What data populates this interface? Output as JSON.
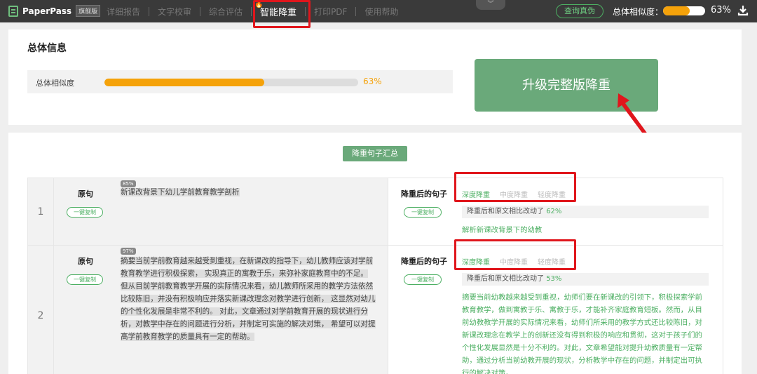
{
  "topbar": {
    "brand": "PaperPass",
    "edition": "旗舰版",
    "nav": [
      "详细报告",
      "文字校审",
      "综合评估",
      "智能降重",
      "打印PDF",
      "使用帮助"
    ],
    "verify_label": "查询真伪",
    "similarity_label": "总体相似度：",
    "similarity_value": 0.63,
    "similarity_pct": "63%"
  },
  "overview": {
    "title": "总体信息",
    "row_label": "总体相似度",
    "pct": "63%",
    "value": 0.63,
    "upgrade_label": "升级完整版降重"
  },
  "summary": {
    "button_label": "降重句子汇总",
    "orig_label": "原句",
    "reduced_label": "降重后的句子",
    "copy_label": "一键复制",
    "tabs": [
      "深度降重",
      "中度降重",
      "轻度降重"
    ],
    "rows": [
      {
        "num": "1",
        "badge": "85%",
        "orig_text": "新课改背景下幼儿学前教育教学剖析",
        "change_prefix": "降重后和原文相比改动了 ",
        "change_pct": "62%",
        "reduced_text": "解析新课改背景下的幼教"
      },
      {
        "num": "2",
        "badge": "97%",
        "orig_text": "摘要当前学前教育越来越受到重视，在新课改的指导下，幼儿教师应该对学前教育教学进行积极探索， 实现真正的寓教于乐，来弥补家庭教育中的不足。 但从目前学前教育教学开展的实际情况来看，幼儿教师所采用的教学方法依然比较陈旧，并没有积极响应并落实新课改理念对教学进行创新， 这显然对幼儿的个性化发展是非常不利的。 对此，文章通过对学前教育开展的现状进行分析，对教学中存在的问题进行分析，并制定可实施的解决对策， 希望可以对提高学前教育教学的质量具有一定的帮助。",
        "change_prefix": "降重后和原文相比改动了 ",
        "change_pct": "53%",
        "reduced_text": "摘要当前幼教越来越受到重视，幼师们要在新课改的引领下，积极探索学前教育教学，做到寓教于乐、寓教于乐，才能补齐家庭教育短板。然而，从目前幼教教学开展的实际情况来看，幼师们所采用的教学方式还比较陈旧，对新课改理念在教学上的创新还没有得到积极的响应和贯彻，这对于孩子们的个性化发展显然是十分不利的。对此，文章希望能对提升幼教质量有一定帮助，通过分析当前幼教开展的现状，分析教学中存在的问题，并制定出可执行的解决对策。"
      }
    ]
  },
  "colors": {
    "accent": "#4caf62",
    "brand_green": "#6aa97a",
    "progress": "#f5a20a",
    "highlight": "#e0161c"
  }
}
